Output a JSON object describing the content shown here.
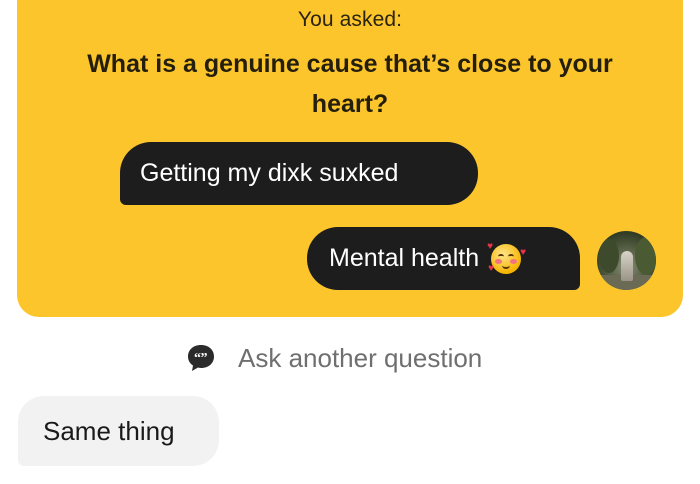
{
  "prompt_card": {
    "asked_label": "You asked:",
    "question": "What is a genuine cause that’s close to your heart?",
    "colors": {
      "card": "#fcc52c",
      "bubble": "#1d1d1d"
    }
  },
  "messages": [
    {
      "side": "left",
      "text": "Getting my dixk suxked"
    },
    {
      "side": "right",
      "text": "Mental health",
      "emoji": "smiling-face-with-hearts"
    }
  ],
  "ask_another": {
    "label": "Ask another question",
    "icon": "quote-bubble-icon"
  },
  "reply": {
    "text": "Same thing"
  }
}
